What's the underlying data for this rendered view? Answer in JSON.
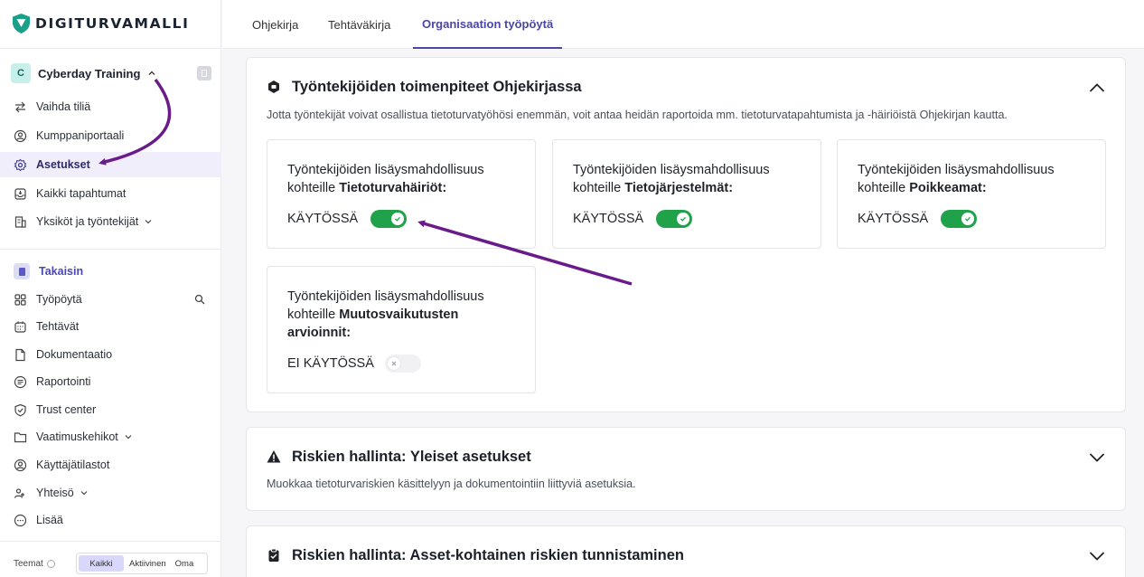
{
  "brand": {
    "name": "DIGITURVAMALLI",
    "accent": "#1aa089"
  },
  "org": {
    "initial": "C",
    "name": "Cyberday Training"
  },
  "sidebar": {
    "account_items": [
      {
        "label": "Vaihda tiliä",
        "icon": "swap-icon"
      },
      {
        "label": "Kumppaniportaali",
        "icon": "partner-icon"
      },
      {
        "label": "Asetukset",
        "icon": "gear-icon",
        "active": true
      },
      {
        "label": "Kaikki tapahtumat",
        "icon": "inbox-icon"
      },
      {
        "label": "Yksiköt ja työntekijät",
        "icon": "building-icon"
      }
    ],
    "back_label": "Takaisin",
    "main_items": [
      {
        "label": "Työpöytä",
        "icon": "grid-icon"
      },
      {
        "label": "Tehtävät",
        "icon": "calendar-icon"
      },
      {
        "label": "Dokumentaatio",
        "icon": "document-icon"
      },
      {
        "label": "Raportointi",
        "icon": "report-icon"
      },
      {
        "label": "Trust center",
        "icon": "shield-icon"
      },
      {
        "label": "Vaatimuskehikot",
        "icon": "folder-icon"
      },
      {
        "label": "Käyttäjätilastot",
        "icon": "user-stats-icon"
      },
      {
        "label": "Yhteisö",
        "icon": "community-icon"
      },
      {
        "label": "Lisää",
        "icon": "more-icon"
      }
    ],
    "themes": {
      "label": "Teemat",
      "options": [
        "Kaikki",
        "Aktiivinen",
        "Oma"
      ],
      "selected": "Kaikki"
    }
  },
  "tabs": [
    {
      "label": "Ohjekirja"
    },
    {
      "label": "Tehtäväkirja"
    },
    {
      "label": "Organisaation työpöytä",
      "active": true
    }
  ],
  "section1": {
    "title": "Työntekijöiden toimenpiteet Ohjekirjassa",
    "description": "Jotta työntekijät voivat osallistua tietoturvatyöhösi enemmän, voit antaa heidän raportoida mm. tietoturvatapahtumista ja -häiriöistä Ohjekirjan kautta.",
    "options": [
      {
        "prefix": "Työntekijöiden lisäysmahdollisuus kohteille ",
        "target": "Tietoturvahäiriöt:",
        "status": "KÄYTÖSSÄ",
        "enabled": true
      },
      {
        "prefix": "Työntekijöiden lisäysmahdollisuus kohteille ",
        "target": "Tietojärjestelmät:",
        "status": "KÄYTÖSSÄ",
        "enabled": true
      },
      {
        "prefix": "Työntekijöiden lisäysmahdollisuus kohteille ",
        "target": "Poikkeamat:",
        "status": "KÄYTÖSSÄ",
        "enabled": true
      },
      {
        "prefix": "Työntekijöiden lisäysmahdollisuus kohteille ",
        "target": "Muutosvaikutusten arvioinnit:",
        "status": "EI KÄYTÖSSÄ",
        "enabled": false
      }
    ]
  },
  "section2": {
    "title": "Riskien hallinta: Yleiset asetukset",
    "description": "Muokkaa tietoturvariskien käsittelyyn ja dokumentointiin liittyviä asetuksia."
  },
  "section3": {
    "title": "Riskien hallinta: Asset-kohtainen riskien tunnistaminen"
  },
  "colors": {
    "toggle_on": "#20a24a",
    "active_tab": "#4a47a6",
    "annotation_arrow": "#6a1b8a"
  }
}
